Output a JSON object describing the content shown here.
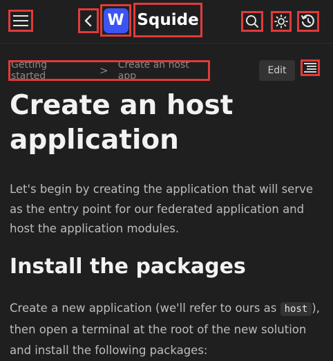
{
  "header": {
    "logo_letter": "W",
    "brand": "Squide",
    "icons": {
      "menu": "hamburger-menu-icon",
      "back": "chevron-left-icon",
      "search": "search-icon",
      "theme": "sun-icon",
      "history": "history-icon"
    }
  },
  "breadcrumb": {
    "items": [
      "Getting started",
      "Create an host app"
    ],
    "separator": ">"
  },
  "toolbar": {
    "edit_label": "Edit",
    "toc_icon": "table-of-contents-icon"
  },
  "page": {
    "title": "Create an host application",
    "intro": "Let's begin by creating the application that will serve as the entry point for our federated application and host the application modules.",
    "section_title": "Install the packages",
    "para_before_code": "Create a new application (we'll refer to ours as ",
    "para_code": "host",
    "para_after_code": "), then open a terminal at the root of the new solution and install the following packages:"
  },
  "colors": {
    "background": "#1f1f1f",
    "accent": "#3b55f5",
    "highlight": "#e23a3a"
  }
}
